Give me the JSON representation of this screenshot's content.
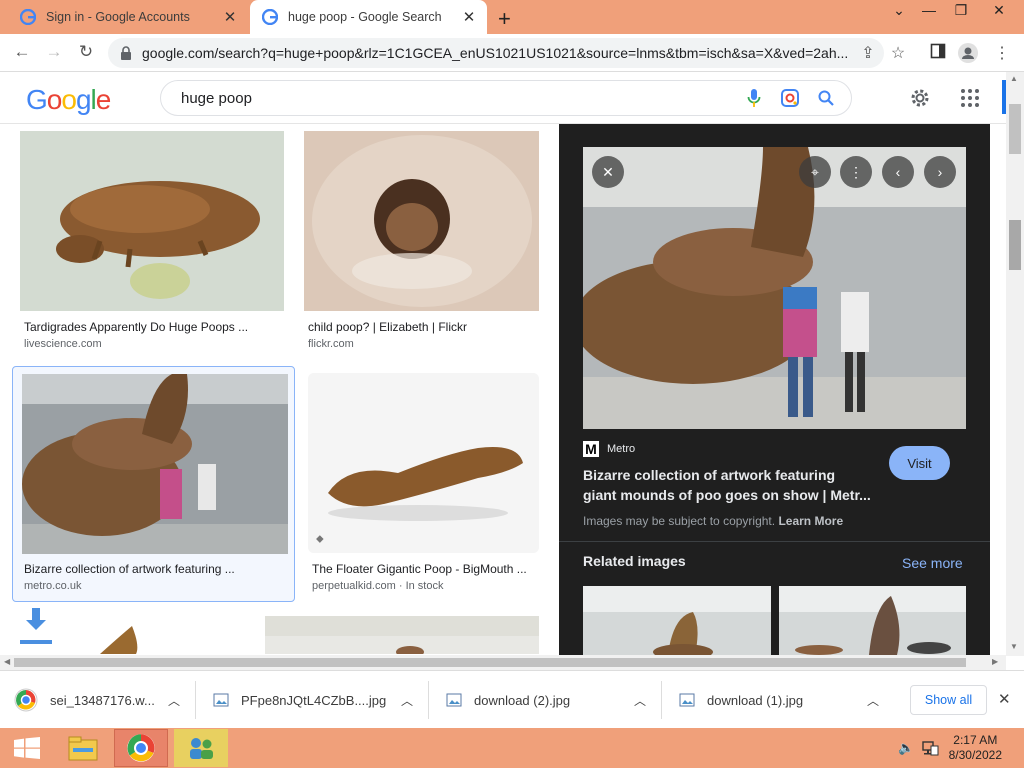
{
  "browser": {
    "tabs": [
      {
        "label": "Sign in - Google Accounts",
        "active": false
      },
      {
        "label": "huge poop - Google Search",
        "active": true
      }
    ],
    "new_tab_icon": "plus-icon",
    "url": "google.com/search?q=huge+poop&rlz=1C1GCEA_enUS1021US1021&source=lnms&tbm=isch&sa=X&ved=2ah..."
  },
  "google": {
    "logo": "Google",
    "search_query": "huge poop"
  },
  "results": [
    {
      "title": "Tardigrades Apparently Do Huge Poops ...",
      "source": "livescience.com"
    },
    {
      "title": "child poop? | Elizabeth | Flickr",
      "source": "flickr.com"
    },
    {
      "title": "Bizarre collection of artwork featuring ...",
      "source": "metro.co.uk"
    },
    {
      "title": "The Floater Gigantic Poop - BigMouth ...",
      "source": "perpetualkid.com",
      "stock": "In stock"
    }
  ],
  "panel": {
    "source_name": "Metro",
    "title_line1": "Bizarre collection of artwork featuring",
    "title_line2": "giant mounds of poo goes on show | Metr...",
    "visit_label": "Visit",
    "copyright": "Images may be subject to copyright.",
    "learn_more": "Learn More",
    "related_label": "Related images",
    "see_more": "See more"
  },
  "downloads": {
    "items": [
      {
        "name": "sei_13487176.w...",
        "icon": "chrome-icon"
      },
      {
        "name": "PFpe8nJQtL4CZbB....jpg",
        "icon": "image-file-icon"
      },
      {
        "name": "download (2).jpg",
        "icon": "image-file-icon"
      },
      {
        "name": "download (1).jpg",
        "icon": "image-file-icon"
      }
    ],
    "show_all": "Show all"
  },
  "taskbar": {
    "time": "2:17 AM",
    "date": "8/30/2022"
  },
  "colors": {
    "accent_blue": "#1a73e8",
    "visit_button": "#8ab4f8",
    "panel_bg": "#1f1f1f",
    "taskbar": "#f0a07a"
  }
}
